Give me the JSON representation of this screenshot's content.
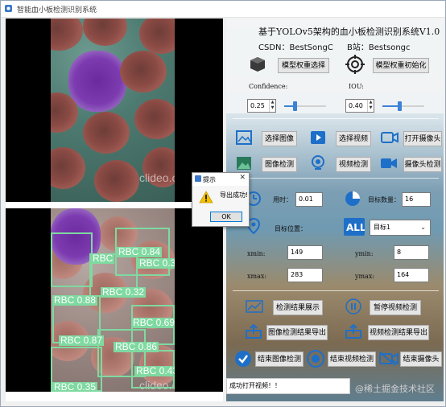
{
  "window": {
    "title": "智能血小板检测识别系统"
  },
  "image_panes": {
    "watermark": "clideo.com"
  },
  "detections": [
    {
      "label": "RBC 0.84"
    },
    {
      "label": "RBC"
    },
    {
      "label": "RBC 0.36"
    },
    {
      "label": "RBC 0.32"
    },
    {
      "label": "RBC 0.88"
    },
    {
      "label": "RBC 0.69"
    },
    {
      "label": "RBC 0.87"
    },
    {
      "label": "RBC 0.86"
    },
    {
      "label": "RBC 0.43"
    },
    {
      "label": "RBC 0.35"
    }
  ],
  "header": {
    "title": "基于YOLOv5架构的血小板检测识别系统V1.0",
    "csdn": "CSDN：BestSongC",
    "bilibili": "B站：Bestsongc"
  },
  "model": {
    "select_label": "模型权重选择",
    "init_label": "模型权重初始化"
  },
  "params": {
    "confidence_label": "Confidence:",
    "confidence_value": "0.25",
    "confidence_level": 0.25,
    "iou_label": "IOU:",
    "iou_value": "0.40",
    "iou_level": 0.4
  },
  "actions": {
    "select_image": "选择图像",
    "select_video": "选择视频",
    "open_camera": "打开摄像头",
    "image_detect": "图像检测",
    "video_detect": "视频检测",
    "camera_detect": "摄像头检测"
  },
  "stats": {
    "time_label": "用时：",
    "time_value": "0.01",
    "count_label": "目标数量：",
    "count_value": "16",
    "position_label": "目标位置：",
    "target_selected": "目标1",
    "xmin_label": "xmin:",
    "xmin_value": "149",
    "ymin_label": "ymin:",
    "ymin_value": "8",
    "xmax_label": "xmax:",
    "xmax_value": "283",
    "ymax_label": "ymax:",
    "ymax_value": "164"
  },
  "results": {
    "show_result": "检测结果展示",
    "pause_video": "暂停视频检测",
    "export_image": "图像检测结果导出",
    "export_video": "视频检测结果导出",
    "end_image": "结束图像检测",
    "end_video": "结束视频检测",
    "end_camera": "结束摄像头"
  },
  "status_bar": {
    "text": "成功打开视频！！"
  },
  "footer_watermark": "@稀土掘金技术社区",
  "dialog": {
    "title": "提示",
    "message": "导出成功!",
    "ok_label": "OK",
    "close_glyph": "✕"
  },
  "colors": {
    "accent": "#3b82d8",
    "box": "#7fd9a0",
    "purple": "#7d3bb0"
  }
}
